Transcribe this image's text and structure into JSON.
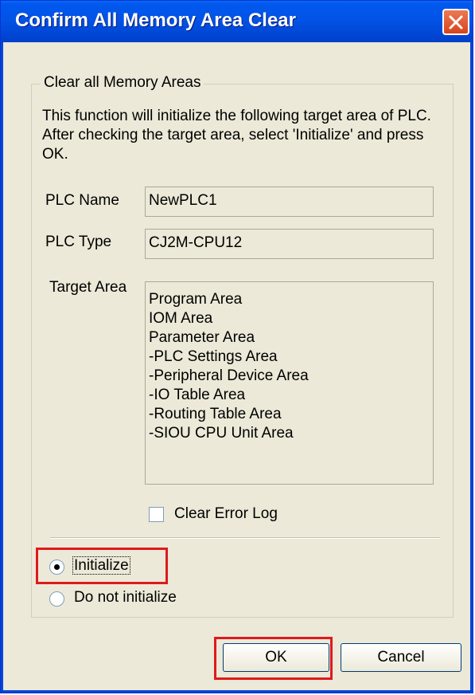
{
  "window": {
    "title": "Confirm All Memory Area Clear"
  },
  "group": {
    "title": "Clear all Memory Areas",
    "description": "This function will initialize the following target area of PLC. After checking the target area, select 'Initialize' and press OK."
  },
  "fields": {
    "plc_name_label": "PLC Name",
    "plc_name_value": "NewPLC1",
    "plc_type_label": "PLC Type",
    "plc_type_value": "CJ2M-CPU12",
    "target_area_label": "Target Area",
    "target_areas": [
      "Program Area",
      "IOM Area",
      "Parameter Area",
      "-PLC Settings Area",
      "-Peripheral Device Area",
      "-IO Table Area",
      "-Routing Table Area",
      "-SIOU CPU Unit Area"
    ]
  },
  "options": {
    "clear_error_log_label": "Clear Error Log",
    "clear_error_log_checked": false,
    "initialize_label": "Initialize",
    "do_not_initialize_label": "Do not initialize",
    "selected": "Initialize"
  },
  "buttons": {
    "ok_label": "OK",
    "cancel_label": "Cancel"
  },
  "colors": {
    "title_bar": "#0046d5",
    "highlight": "#e0191c",
    "window_bg": "#ece9d8"
  }
}
